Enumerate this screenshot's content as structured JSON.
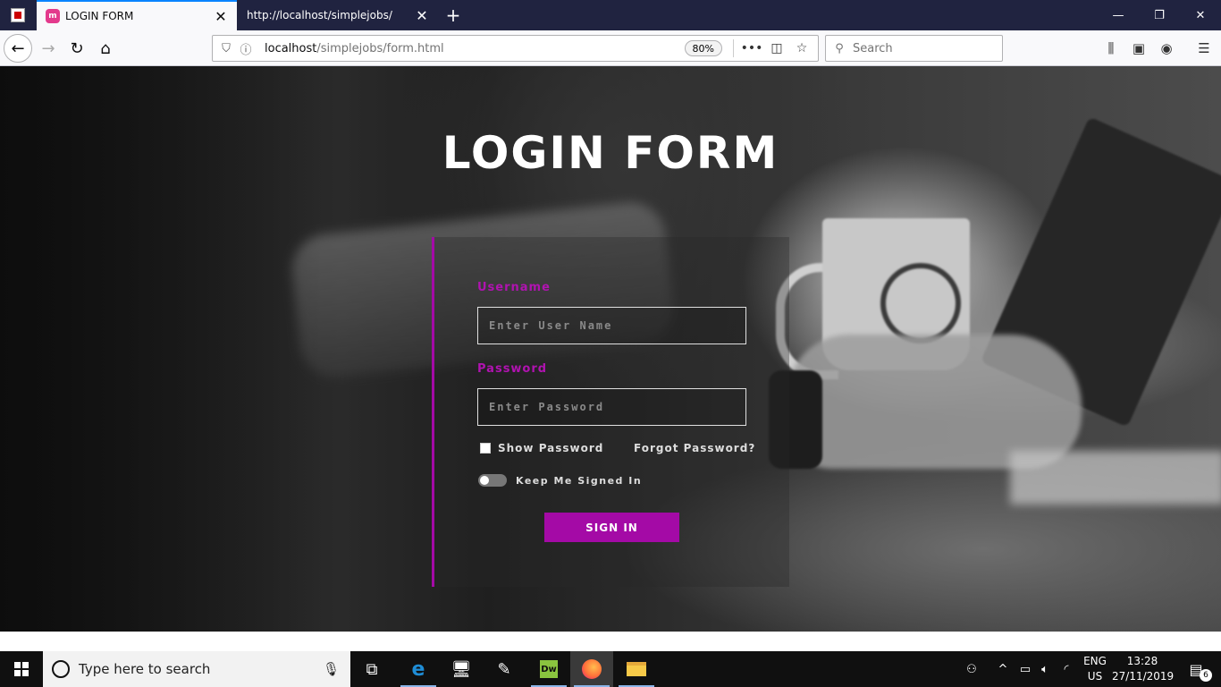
{
  "browser": {
    "tabs": [
      {
        "label": "LOGIN FORM",
        "active": true,
        "favicon": "site-icon"
      },
      {
        "label": "http://localhost/simplejobs/",
        "active": false
      }
    ],
    "url_host": "localhost",
    "url_path": "/simplejobs/form.html",
    "zoom": "80%",
    "search_placeholder": "Search"
  },
  "page": {
    "title": "LOGIN FORM",
    "accent_color": "#a40aa6",
    "form": {
      "username_label": "Username",
      "username_placeholder": "Enter User Name",
      "password_label": "Password",
      "password_placeholder": "Enter Password",
      "show_password_label": "Show Password",
      "forgot_password_label": "Forgot Password?",
      "keep_signed_in_label": "Keep Me Signed In",
      "signin_label": "SIGN IN"
    }
  },
  "taskbar": {
    "search_placeholder": "Type here to search",
    "apps": [
      "task-view-icon",
      "edge-icon",
      "network-icon",
      "notepad-icon",
      "dreamweaver-icon",
      "firefox-icon",
      "file-explorer-icon"
    ],
    "dw_label": "Dw",
    "lang_top": "ENG",
    "lang_bottom": "US",
    "time": "13:28",
    "date": "27/11/2019",
    "notification_count": "6"
  }
}
